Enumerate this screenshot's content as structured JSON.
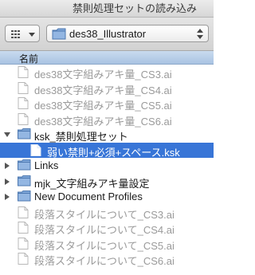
{
  "window": {
    "title": "禁則処理セットの読み込み"
  },
  "toolbar": {
    "path_label": "des38_Illustrator"
  },
  "list": {
    "column_header": "名前",
    "rows": [
      {
        "label": "des38文字組みアキ量_CS3.ai",
        "kind": "file",
        "state": "dim"
      },
      {
        "label": "des38文字組みアキ量_CS4.ai",
        "kind": "file",
        "state": "dim"
      },
      {
        "label": "des38文字組みアキ量_CS5.ai",
        "kind": "file",
        "state": "dim"
      },
      {
        "label": "des38文字組みアキ量_CS6.ai",
        "kind": "file",
        "state": "dim"
      },
      {
        "label": "ksk_禁則処理セット",
        "kind": "folder",
        "state": "expanded"
      },
      {
        "label": "弱い禁則+必須+スペース.ksk",
        "kind": "file",
        "state": "selected"
      },
      {
        "label": "Links",
        "kind": "folder",
        "state": "collapsed"
      },
      {
        "label": "mjk_文字組みアキ量設定",
        "kind": "folder",
        "state": "collapsed"
      },
      {
        "label": "New Document Profiles",
        "kind": "folder",
        "state": "collapsed"
      },
      {
        "label": "段落スタイルについて_CS3.ai",
        "kind": "file",
        "state": "dim"
      },
      {
        "label": "段落スタイルについて_CS4.ai",
        "kind": "file",
        "state": "dim"
      },
      {
        "label": "段落スタイルについて_CS5.ai",
        "kind": "file",
        "state": "dim"
      },
      {
        "label": "段落スタイルについて_CS6.ai",
        "kind": "file",
        "state": "dim"
      }
    ]
  },
  "colors": {
    "selection": "#3875d7",
    "folder": "#6f9ad0",
    "dim_text": "#9a9a9a"
  }
}
